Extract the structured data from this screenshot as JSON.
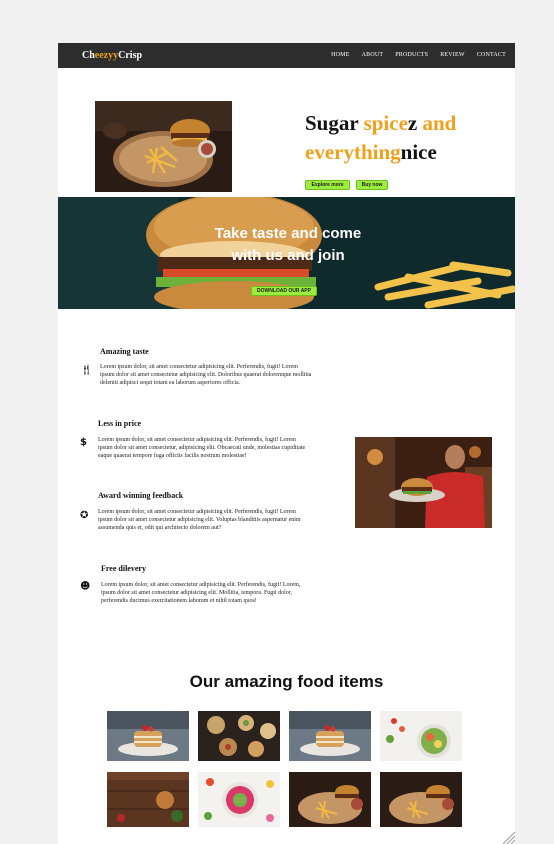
{
  "nav": {
    "logo_prefix": "Ch",
    "logo_highlight": "eezyy",
    "logo_suffix": "Crisp",
    "links": [
      "HOME",
      "ABOUT",
      "PRODUCTS",
      "REVIEW",
      "CONTACT"
    ]
  },
  "hero": {
    "headline_1": "Sugar ",
    "headline_2": "spice",
    "headline_3": "z ",
    "headline_4": "and",
    "headline_5": "everything",
    "headline_6": "nice",
    "explore_button": "Explore more",
    "buy_button": "Buy now"
  },
  "banner": {
    "text": "Take taste and come with us and join",
    "download_button": "DOWNLOAD OUR APP"
  },
  "features": [
    {
      "title": "Amazing taste",
      "text": "Lorem ipsum dolor, sit amet consectetur adipisicing elit. Perferendis, fugit! Lorem ipsum dolor sit amet consectetur adipisicing elit. Doloribus quaerat doloremque mollitia deleniti adipisci sequi totam ea laborum asperiores officia.",
      "icon": "utensils-icon"
    },
    {
      "title": "Less in price",
      "text": "Lorem ipsum dolor, sit amet consectetur adipisicing elit. Perferendis, fugit! Lorem ipsum dolor sit amet consectetur, adipisicing elit. Obcaecati unde, molestias cupiditate eaque quaerat tempore fuga officiis facilis nostrum molestiae!",
      "icon": "dollar-icon"
    },
    {
      "title": "Award winning feedback",
      "text": "Lorem ipsum dolor, sit amet consectetur adipisicing elit. Perferendis, fugit! Lorem ipsum dolor sit amet consectetur adipisicing elit. Voluptas blanditiis aspernatur enim assumenda quis et, odit qui architecto dolorem aut?",
      "icon": "award-icon"
    },
    {
      "title": "Free dilevery",
      "text": "Lorem ipsum dolor, sit amet consectetur adipisicing elit. Perferendis, fugit! Lorem, ipsum dolor sit amet consectetur adipisicing elit. Mollitia, tempora. Fugit dolor, perferendis ducimus exercitationem laborum et nihil totam quos!",
      "icon": "smile-icon"
    }
  ],
  "food_section": {
    "title": "Our amazing food items"
  },
  "colors": {
    "accent": "#f0a11a",
    "button_green": "#9ded3f",
    "nav_bg": "#2d2d2d"
  }
}
